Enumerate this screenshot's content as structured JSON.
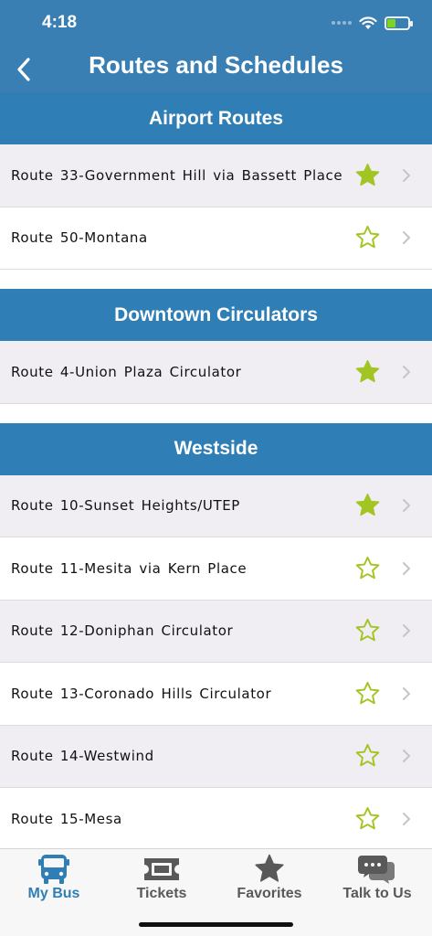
{
  "status_bar": {
    "time": "4:18"
  },
  "header": {
    "title": "Routes and Schedules",
    "back_icon": "chevron-left-icon"
  },
  "colors": {
    "header_bg": "#3a7fb3",
    "section_bg": "#2f7fb6",
    "star": "#a3c524",
    "active_tab": "#2f7fb6",
    "alt_row": "#f0edf3"
  },
  "sections": [
    {
      "title": "Airport Routes",
      "routes": [
        {
          "label": "Route 33-Government Hill via Bassett Place",
          "favorite": true
        },
        {
          "label": "Route 50-Montana",
          "favorite": false
        }
      ]
    },
    {
      "title": "Downtown Circulators",
      "routes": [
        {
          "label": "Route 4-Union Plaza Circulator",
          "favorite": true
        }
      ]
    },
    {
      "title": "Westside",
      "routes": [
        {
          "label": "Route 10-Sunset Heights/UTEP",
          "favorite": true
        },
        {
          "label": "Route 11-Mesita via Kern Place",
          "favorite": false
        },
        {
          "label": "Route 12-Doniphan Circulator",
          "favorite": false
        },
        {
          "label": "Route 13-Coronado Hills Circulator",
          "favorite": false
        },
        {
          "label": "Route 14-Westwind",
          "favorite": false
        },
        {
          "label": "Route 15-Mesa",
          "favorite": false
        }
      ]
    }
  ],
  "tabs": [
    {
      "label": "My Bus",
      "icon": "bus-icon",
      "active": true
    },
    {
      "label": "Tickets",
      "icon": "ticket-icon",
      "active": false
    },
    {
      "label": "Favorites",
      "icon": "star-icon",
      "active": false
    },
    {
      "label": "Talk to Us",
      "icon": "chat-bubbles-icon",
      "active": false
    }
  ]
}
